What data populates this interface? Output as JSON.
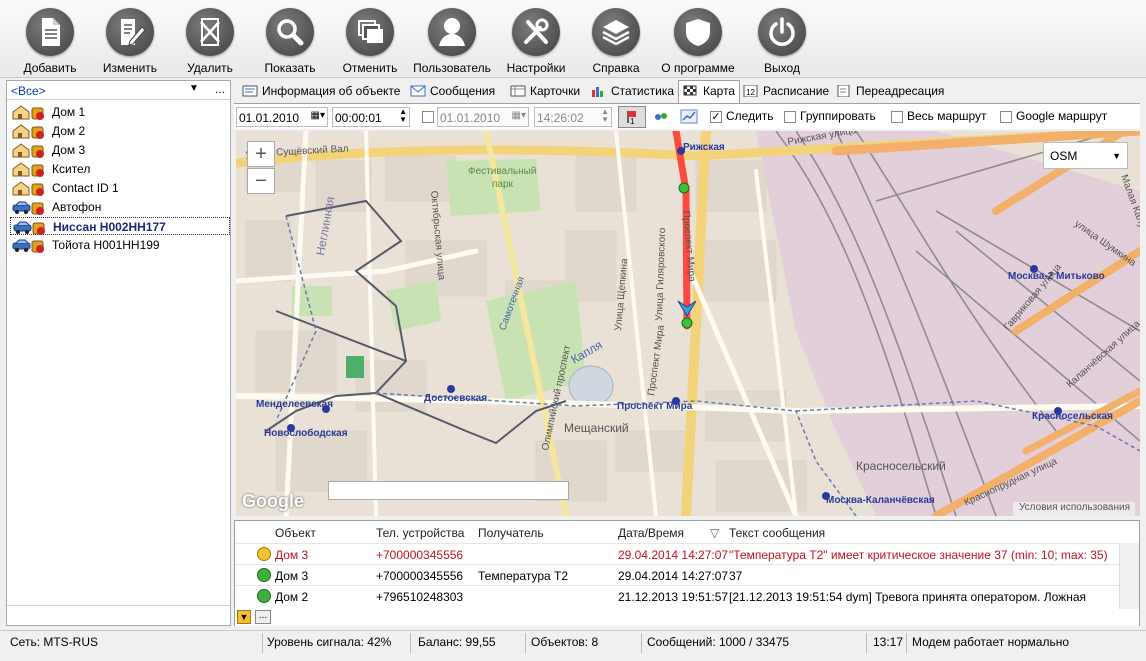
{
  "toolbar": {
    "buttons": [
      {
        "label": "Добавить",
        "icon": "document-icon"
      },
      {
        "label": "Изменить",
        "icon": "edit-document-icon"
      },
      {
        "label": "Удалить",
        "icon": "delete-document-icon"
      },
      {
        "label": "Показать",
        "icon": "search-icon"
      },
      {
        "label": "Отменить",
        "icon": "windows-icon"
      },
      {
        "label": "Пользователь",
        "icon": "user-icon"
      },
      {
        "label": "Настройки",
        "icon": "tools-icon"
      },
      {
        "label": "Справка",
        "icon": "layers-icon"
      },
      {
        "label": "О программе",
        "icon": "shield-icon"
      },
      {
        "label": "Выход",
        "icon": "power-icon"
      }
    ]
  },
  "objects_panel": {
    "filter": "<Все>",
    "filter_more": "...",
    "items": [
      {
        "label": "Дом 1",
        "type": "house"
      },
      {
        "label": "Дом 2",
        "type": "house"
      },
      {
        "label": "Дом 3",
        "type": "house"
      },
      {
        "label": "Ксител",
        "type": "house"
      },
      {
        "label": "Contact ID 1",
        "type": "house"
      },
      {
        "label": "Автофон",
        "type": "car"
      },
      {
        "label": "Ниссан Н002НН177",
        "type": "car",
        "selected": true
      },
      {
        "label": "Тойота Н001НН199",
        "type": "car"
      }
    ]
  },
  "tabs": [
    {
      "label": "Информация об объекте"
    },
    {
      "label": "Сообщения"
    },
    {
      "label": "Карточки"
    },
    {
      "label": "Статистика"
    },
    {
      "label": "Карта",
      "active": true
    },
    {
      "label": "Расписание"
    },
    {
      "label": "Переадресация"
    }
  ],
  "map_toolbar": {
    "date_from": "01.01.2010",
    "time_from": "00:00:01",
    "date_to": "01.01.2010",
    "time_to": "14:26:02",
    "follow_label": "Следить",
    "follow_checked": true,
    "group_label": "Группировать",
    "whole_route_label": "Весь маршрут",
    "google_route_label": "Google маршрут"
  },
  "map": {
    "layer": "OSM",
    "zoom_in": "+",
    "zoom_out": "−",
    "google_logo": "Google",
    "terms": "Условия использования",
    "labels": [
      "улица Сущёвский Вал",
      "Рижская",
      "Рижская улица",
      "Фестивальный парк",
      "Октябрьская улица",
      "Неглинная",
      "Самотечная",
      "Олимпийский проспект",
      "Улица Щепкина",
      "Улица Гиляровского",
      "Проспект Мира",
      "Проспект Мира",
      "Мещанский",
      "Менделеевская",
      "Новослободская",
      "Достоевская",
      "Красносельский",
      "Москва-Каланчёвская",
      "Красносельская",
      "Москва-2 Митьково",
      "улица Шумкина",
      "Гавриковая улица",
      "Каланчёвская улица",
      "Краснопрудная улица",
      "Малая Калужская",
      "Капля"
    ]
  },
  "messages": {
    "headers": [
      "Объект",
      "Тел. устройства",
      "Получатель",
      "Дата/Время",
      "Текст сообщения"
    ],
    "rows": [
      {
        "status": "warning",
        "object": "Дом 3",
        "phone": "+700000345556",
        "recipient": "",
        "datetime": "29.04.2014 14:27:07",
        "text": "\"Температура Т2\" имеет критическое значение 37 (min: 10; max: 35)"
      },
      {
        "status": "ok",
        "object": "Дом 3",
        "phone": "+700000345556",
        "recipient": "Температура Т2",
        "datetime": "29.04.2014 14:27:07",
        "text": "37"
      },
      {
        "status": "ok",
        "object": "Дом 2",
        "phone": "+796510248303",
        "recipient": "",
        "datetime": "21.12.2013 19:51:57",
        "text": "[21.12.2013 19:51:54 dym] Тревога принята оператором. Ложная"
      }
    ],
    "sort_indicator": "▽",
    "more_button": "..."
  },
  "status_bar": {
    "network": "Сеть: MTS-RUS",
    "signal": "Уровень сигнала: 42%",
    "balance": "Баланс: 99,55",
    "objects": "Объектов: 8",
    "messages": "Сообщений: 1000 / 33475",
    "time": "13:17",
    "modem": "Модем работает нормально"
  },
  "colors": {
    "accent_blue": "#1a2a7a",
    "alert_red": "#c0141c",
    "route_red": "#ff3b2f",
    "ok_green": "#3fae3b",
    "warning_yellow": "#f2c230"
  }
}
